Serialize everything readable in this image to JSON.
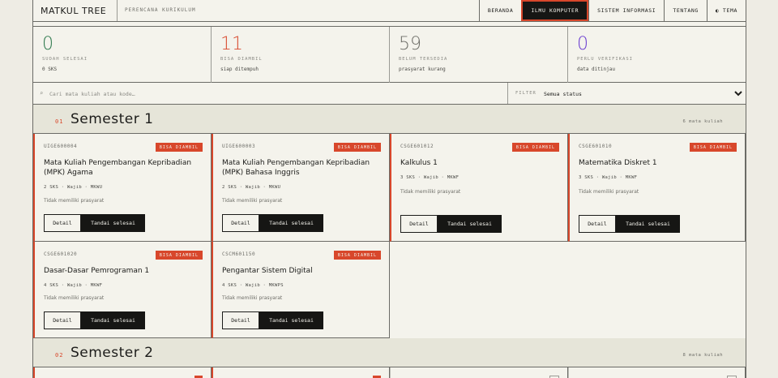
{
  "header": {
    "brand": "MATKUL TREE",
    "subtitle": "PERENCANA KURIKULUM",
    "nav": [
      "BERANDA",
      "ILMU KOMPUTER",
      "SISTEM INFORMASI",
      "TENTANG",
      "◐ TEMA"
    ],
    "active_nav": "ILMU KOMPUTER"
  },
  "stats": [
    {
      "value": "0",
      "label": "SUDAH SELESAI",
      "sub": "0 SKS",
      "color": "#2f7a4e"
    },
    {
      "value": "11",
      "label": "BISA DIAMBIL",
      "sub": "siap ditempuh",
      "color": "#d8472b"
    },
    {
      "value": "59",
      "label": "BELUM TERSEDIA",
      "sub": "prasyarat kurang",
      "color": "#6e6e68"
    },
    {
      "value": "0",
      "label": "PERLU VERIFIKASI",
      "sub": "data ditinjau",
      "color": "#6c3fd1"
    }
  ],
  "search": {
    "icon": "⌕",
    "placeholder": "Cari mata kuliah atau kode…",
    "value": ""
  },
  "filter": {
    "label": "FILTER",
    "selected": "Semua status"
  },
  "semesters": [
    {
      "num": "01",
      "title": "Semester 1",
      "count": "6 mata kuliah",
      "courses": [
        {
          "code": "UIGE600004",
          "badge": "BISA DIAMBIL",
          "name": "Mata Kuliah Pengembangan Kepribadian (MPK) Agama",
          "meta": "2 SKS · Wajib · MKWU",
          "prereq": "Tidak memiliki prasyarat",
          "detail": "Detail",
          "done": "Tandai selesai"
        },
        {
          "code": "UIGE600003",
          "badge": "BISA DIAMBIL",
          "name": "Mata Kuliah Pengembangan Kepribadian (MPK) Bahasa Inggris",
          "meta": "2 SKS · Wajib · MKWU",
          "prereq": "Tidak memiliki prasyarat",
          "detail": "Detail",
          "done": "Tandai selesai"
        },
        {
          "code": "CSGE601012",
          "badge": "BISA DIAMBIL",
          "name": "Kalkulus 1",
          "meta": "3 SKS · Wajib · MKWF",
          "prereq": "Tidak memiliki prasyarat",
          "detail": "Detail",
          "done": "Tandai selesai"
        },
        {
          "code": "CSGE601010",
          "badge": "BISA DIAMBIL",
          "name": "Matematika Diskret 1",
          "meta": "3 SKS · Wajib · MKWF",
          "prereq": "Tidak memiliki prasyarat",
          "detail": "Detail",
          "done": "Tandai selesai"
        },
        {
          "code": "CSGE601020",
          "badge": "BISA DIAMBIL",
          "name": "Dasar-Dasar Pemrograman 1",
          "meta": "4 SKS · Wajib · MKWF",
          "prereq": "Tidak memiliki prasyarat",
          "detail": "Detail",
          "done": "Tandai selesai"
        },
        {
          "code": "CSCM601150",
          "badge": "BISA DIAMBIL",
          "name": "Pengantar Sistem Digital",
          "meta": "4 SKS · Wajib · MKWPS",
          "prereq": "Tidak memiliki prasyarat",
          "detail": "Detail",
          "done": "Tandai selesai"
        }
      ]
    },
    {
      "num": "02",
      "title": "Semester 2",
      "count": "8 mata kuliah"
    }
  ]
}
